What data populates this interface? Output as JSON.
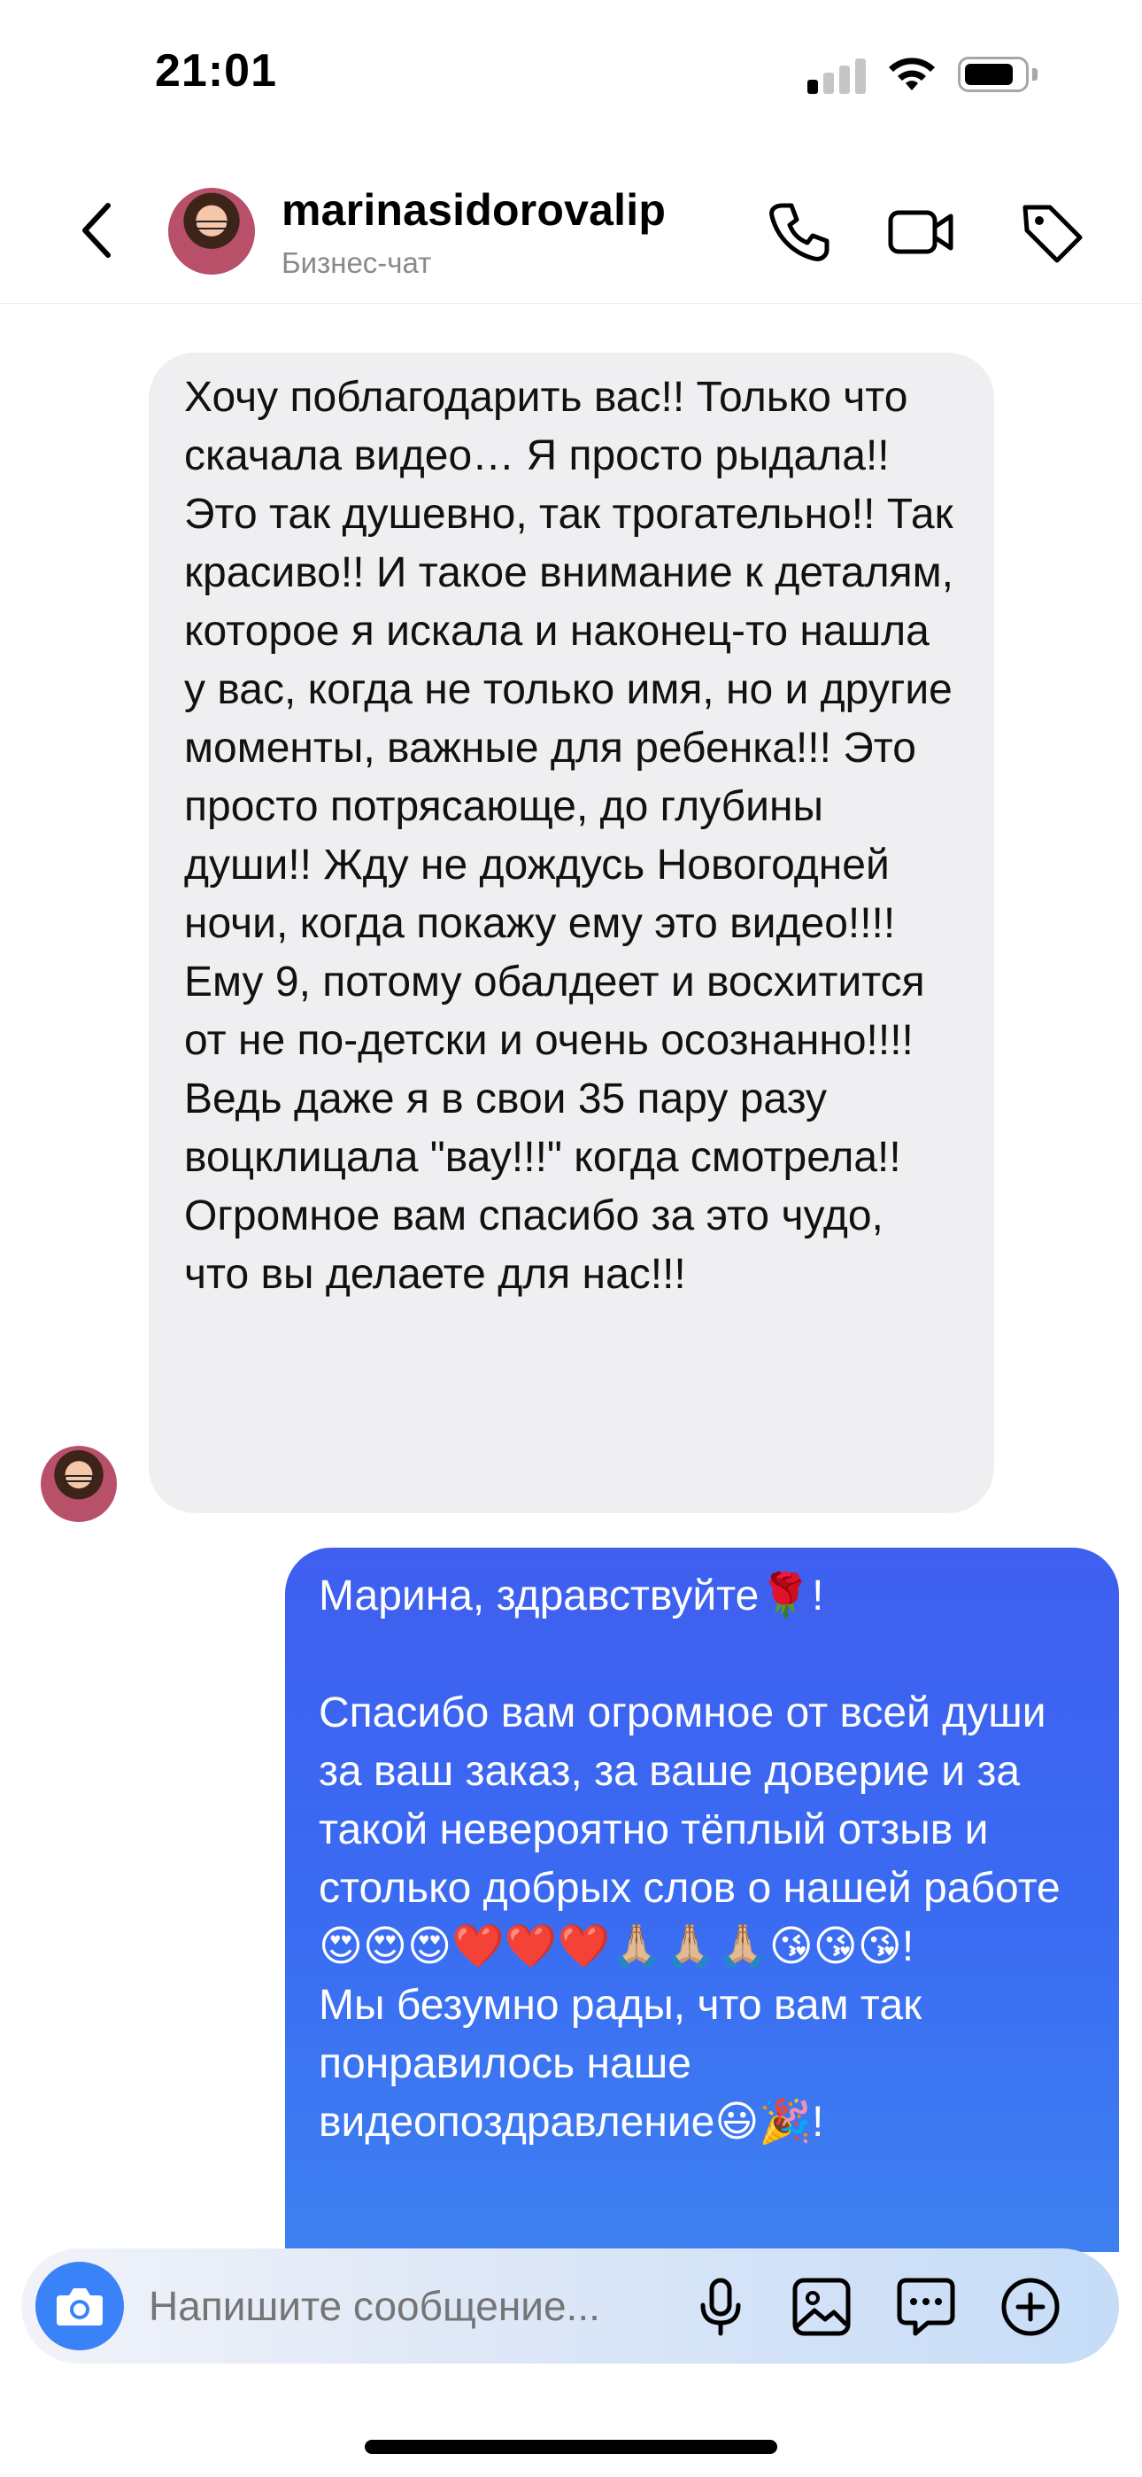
{
  "status_bar": {
    "time": "21:01",
    "battery_level": 0.85
  },
  "header": {
    "username": "marinasidorovalip",
    "subtitle": "Бизнес-чат",
    "icons": [
      "back-chevron-icon",
      "phone-icon",
      "video-camera-icon",
      "tag-icon"
    ]
  },
  "messages": [
    {
      "direction": "incoming",
      "text": "Хочу поблагодарить вас!! Только что скачала видео… Я просто рыдала!! Это так душевно, так трогательно!! Так красиво!! И такое внимание к деталям, которое я искала и наконец-то нашла у вас, когда не только имя, но и другие моменты, важные для ребенка!!! Это просто потрясающе, до глубины души!! Жду не дождусь Новогодней ночи, когда покажу ему это видео!!!! Ему 9, потому обалдеет и восхитится от не по-детски и очень осознанно!!!! Ведь даже я в свои 35 пару разу воцклицала \"вау!!!\" когда смотрела!! Огромное вам спасибо за это чудо, что вы делаете для нас!!!"
    },
    {
      "direction": "outgoing",
      "text": "Марина, здравствуйте🌹!\n\nСпасибо вам огромное от всей души за ваш заказ, за ваше доверие и за такой невероятно тёплый отзыв и столько добрых слов о нашей работе😍😍😍❤️❤️❤️🙏🏼🙏🏼🙏🏼😘😘😘!\nМы безумно рады, что вам так понравилось наше видеопоздравление😃🎉!"
    }
  ],
  "composer": {
    "placeholder": "Напишите сообщение...",
    "icons": [
      "camera-icon",
      "microphone-icon",
      "gallery-icon",
      "sticker-icon",
      "plus-icon"
    ]
  },
  "colors": {
    "incoming_bubble": "#efeff2",
    "outgoing_bubble_top": "#3f5ff0",
    "outgoing_bubble_bottom": "#3f86f0",
    "accent": "#3a82f7"
  }
}
